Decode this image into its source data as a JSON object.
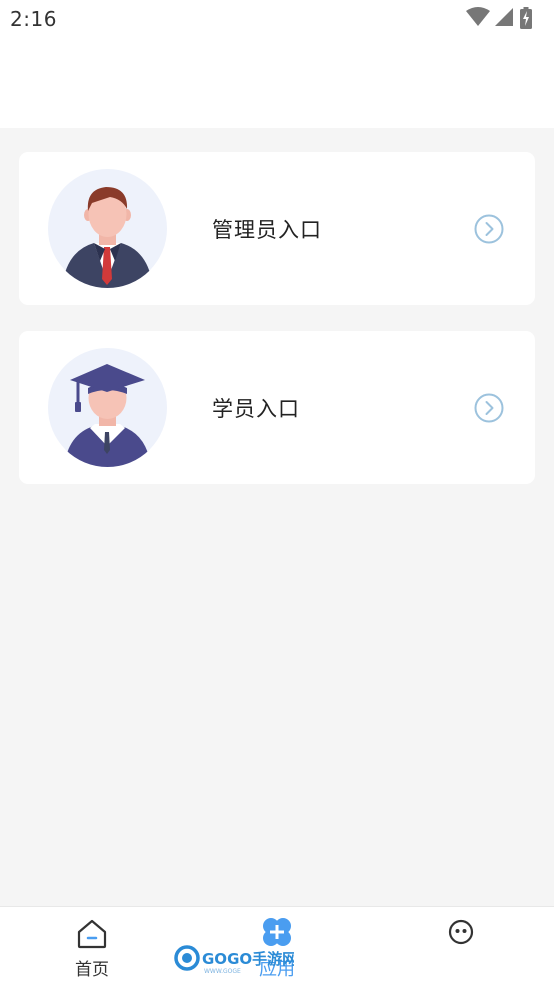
{
  "status_bar": {
    "time": "2:16",
    "icons": [
      "wifi-icon",
      "signal-icon",
      "battery-charging-icon"
    ]
  },
  "entries": [
    {
      "label": "管理员入口",
      "avatar": "admin-avatar",
      "action_icon": "chevron-right-circle-icon"
    },
    {
      "label": "学员入口",
      "avatar": "student-graduate-avatar",
      "action_icon": "chevron-right-circle-icon"
    }
  ],
  "bottom_nav": {
    "items": [
      {
        "label": "首页",
        "icon": "home-icon"
      },
      {
        "label": "应用",
        "icon": "apps-plus-icon"
      },
      {
        "label": "",
        "icon": "profile-face-icon"
      }
    ]
  },
  "watermark": {
    "text": "GOGO手游网",
    "subtext": "WWW.GOGE..."
  },
  "colors": {
    "background": "#f5f5f5",
    "card": "#ffffff",
    "accent": "#4a9df0",
    "chevron": "#9cc2dd"
  }
}
